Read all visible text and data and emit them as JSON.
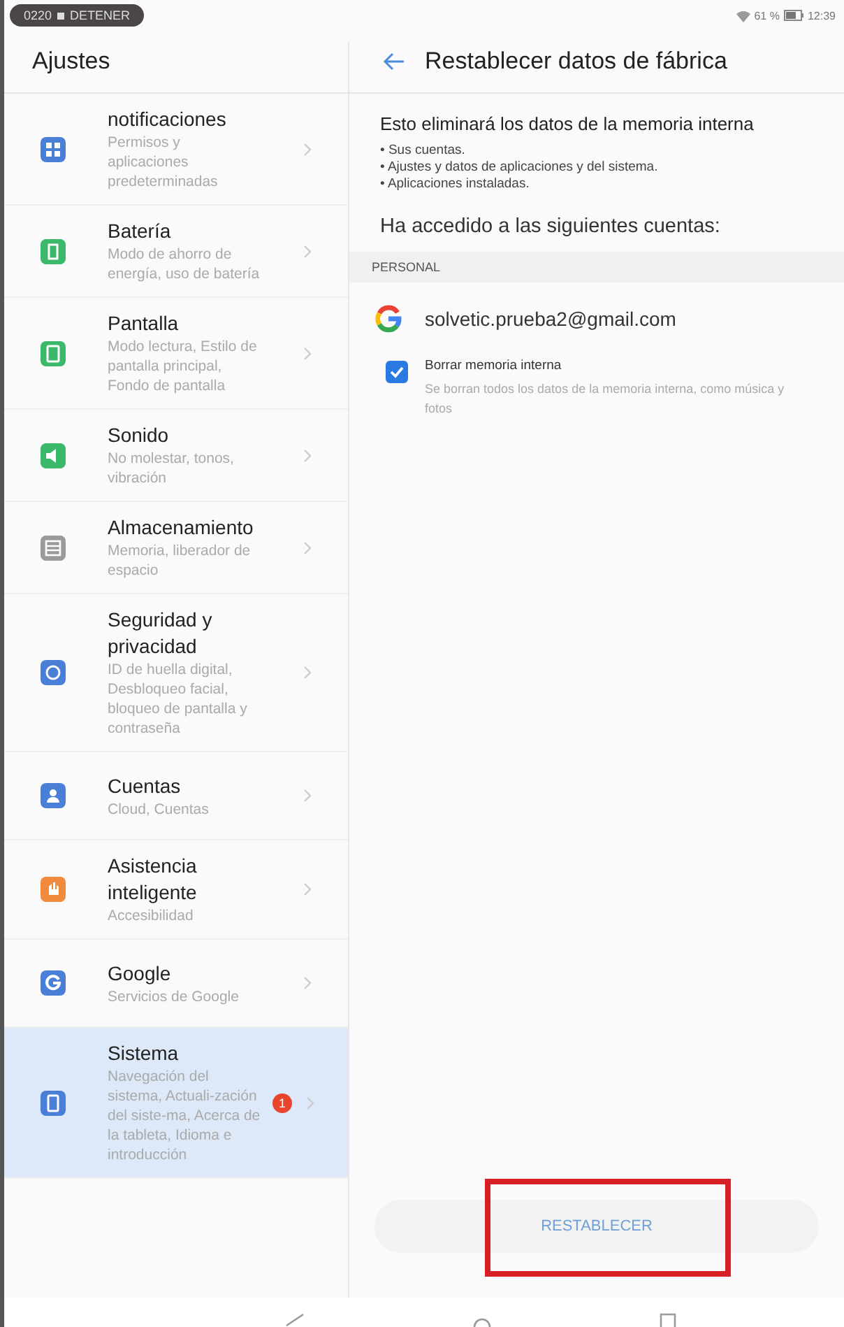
{
  "status_bar": {
    "recording_time": "0220",
    "recording_action": "DETENER",
    "battery": "61 %",
    "time": "12:39"
  },
  "sidebar": {
    "title": "Ajustes",
    "items": [
      {
        "kind": "apps",
        "title": "notificaciones",
        "subtitle": "Permisos y aplicaciones predeterminadas",
        "color": "#4a7fd8",
        "selected": false
      },
      {
        "kind": "battery",
        "title": "Batería",
        "subtitle": "Modo de ahorro de energía, uso de batería",
        "color": "#3cb86a",
        "selected": false
      },
      {
        "kind": "display",
        "title": "Pantalla",
        "subtitle": "Modo lectura, Estilo de pantalla principal, Fondo de pantalla",
        "color": "#3cb86a",
        "selected": false
      },
      {
        "kind": "sound",
        "title": "Sonido",
        "subtitle": "No molestar, tonos, vibración",
        "color": "#3cb86a",
        "selected": false
      },
      {
        "kind": "storage",
        "title": "Almacenamiento",
        "subtitle": "Memoria, liberador de espacio",
        "color": "#9a9a9a",
        "selected": false
      },
      {
        "kind": "security",
        "title": "Seguridad y privacidad",
        "subtitle": "ID de huella digital, Desbloqueo facial, bloqueo de pantalla y contraseña",
        "color": "#4a7fd8",
        "selected": false
      },
      {
        "kind": "account",
        "title": "Cuentas",
        "subtitle": "Cloud, Cuentas",
        "color": "#4a7fd8",
        "selected": false
      },
      {
        "kind": "assist",
        "title": "Asistencia inteligente",
        "subtitle": "Accesibilidad",
        "color": "#f08a3c",
        "selected": false
      },
      {
        "kind": "google",
        "title": "Google",
        "subtitle": "Servicios de Google",
        "color": "#4a7fd8",
        "selected": false
      },
      {
        "kind": "system",
        "title": "Sistema",
        "subtitle": "Navegación del sistema, Actuali-zación del siste-ma, Acerca de la tableta, Idioma e introducción",
        "color": "#4a7fd8",
        "selected": true,
        "badge": "1"
      }
    ]
  },
  "detail": {
    "title": "Restablecer datos de fábrica",
    "intro": "Esto eliminará los datos de la memoria interna",
    "bullets": [
      "• Sus cuentas.",
      "• Ajustes y datos de aplicaciones y del sistema.",
      "• Aplicaciones instaladas."
    ],
    "accounts_heading": "Ha accedido a las siguientes cuentas:",
    "section_label": "PERSONAL",
    "account": "solvetic.prueba2@gmail.com",
    "option": {
      "label": "Borrar memoria interna",
      "description": "Se borran todos los datos de la memoria interna, como música y fotos",
      "checked": true
    },
    "reset_button": {
      "label": "RESTABLECER",
      "highlighted": true
    }
  }
}
